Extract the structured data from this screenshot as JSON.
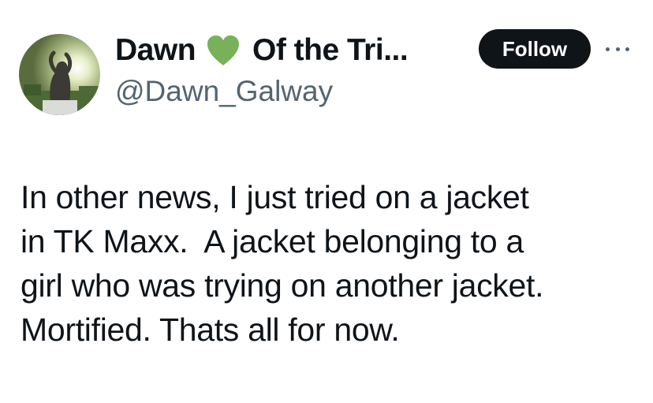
{
  "author": {
    "name_part1": "Dawn",
    "name_part2": "Of the Tri...",
    "heart_icon": "green-heart-icon",
    "heart_color": "#78b159",
    "handle": "@Dawn_Galway",
    "avatar_icon": "profile-avatar"
  },
  "actions": {
    "follow_label": "Follow",
    "more_icon": "more-options-icon"
  },
  "tweet": {
    "lines": [
      "In other news, I just tried on a jacket",
      "in TK Maxx.  A jacket belonging to a",
      "girl who was trying on another jacket.",
      "Mortified. Thats all for now."
    ]
  },
  "colors": {
    "text": "#0f1419",
    "secondary_text": "#536471",
    "follow_button_bg": "#0f1419",
    "follow_button_text": "#ffffff"
  }
}
